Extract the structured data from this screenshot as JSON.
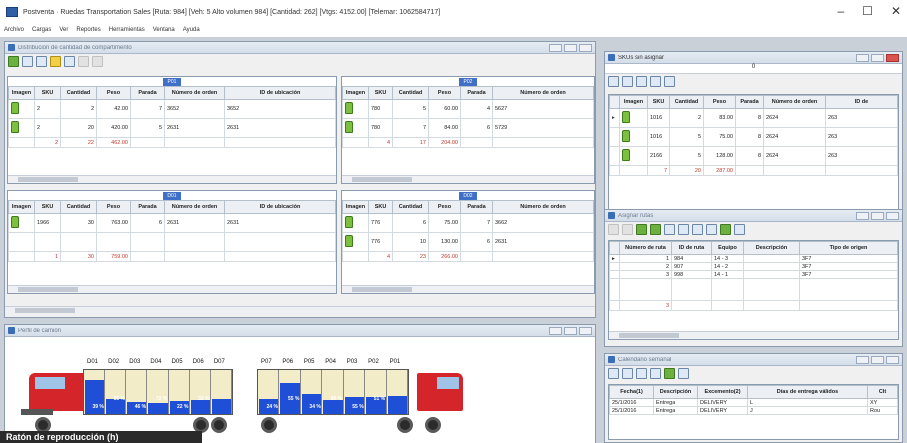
{
  "window": {
    "title": "Postventa · Ruedas Transportation Sales [Ruta: 984] [Veh: 5 Alto volumen 984] [Cantidad: 262] [Vtgs: 4152.00] [Telemar: 1062584717]",
    "controls": [
      "–",
      "☐",
      "✕"
    ]
  },
  "menu": [
    "Archivo",
    "Cargas",
    "Ver",
    "Reportes",
    "Herramientas",
    "Ventana",
    "Ayuda"
  ],
  "panels": {
    "main_title": "Distribución de cantidad de compartimento",
    "skus_title": "SKUs sin asignar",
    "routes_title": "Asignar rutas",
    "perfil_title": "Perfil de camión",
    "calendar_title": "Calendario semanal"
  },
  "columns": [
    "Imagen",
    "SKU",
    "Cantidad",
    "Peso",
    "Parada",
    "Número de orden",
    "ID de ubicación"
  ],
  "grids": [
    {
      "code": "P01",
      "rows": [
        [
          "2",
          "2",
          "42.00",
          "7",
          "3652",
          "3652"
        ],
        [
          "2",
          "20",
          "420.00",
          "5",
          "2631",
          "2631"
        ]
      ],
      "total": [
        "2",
        "22",
        "462.00"
      ]
    },
    {
      "code": "P02",
      "rows": [
        [
          "780",
          "5",
          "60.00",
          "4",
          "5627"
        ],
        [
          "780",
          "7",
          "84.00",
          "6",
          "5729"
        ]
      ],
      "total": [
        "4",
        "17",
        "204.00"
      ]
    },
    {
      "code": "D01",
      "rows": [
        [
          "1966",
          "30",
          "763.00",
          "6",
          "2631",
          "2631"
        ]
      ],
      "total": [
        "1",
        "30",
        "759.00"
      ]
    },
    {
      "code": "D02",
      "rows": [
        [
          "776",
          "6",
          "75.00",
          "7",
          "3662"
        ],
        [
          "776",
          "10",
          "130.00",
          "6",
          "2631"
        ]
      ],
      "total": [
        "4",
        "23",
        "266.00"
      ]
    }
  ],
  "skus": {
    "header": "0",
    "columns": [
      "Imagen",
      "SKU",
      "Cantidad",
      "Peso",
      "Parada",
      "Número de orden",
      "ID de"
    ],
    "rows": [
      [
        "1016",
        "2",
        "83.00",
        "8",
        "2624",
        "263"
      ],
      [
        "1016",
        "5",
        "75.00",
        "8",
        "2624",
        "263"
      ],
      [
        "2166",
        "5",
        "128.00",
        "8",
        "2624",
        "263"
      ]
    ],
    "total": [
      "7",
      "20",
      "287.00"
    ]
  },
  "routes": {
    "columns": [
      "Número de ruta",
      "ID de ruta",
      "Equipo",
      "Descripción",
      "Tipo de origen"
    ],
    "rows": [
      [
        "1",
        "984",
        "14 - 3",
        "3F7"
      ],
      [
        "2",
        "907",
        "14 - 2",
        "3F7"
      ],
      [
        "3",
        "998",
        "14 - 1",
        "3F7"
      ]
    ],
    "total": "3"
  },
  "calendar": {
    "columns": [
      "Fecha(1)",
      "Descripción",
      "Excemento(2)",
      "Días de entrega válidos",
      "Clt"
    ],
    "rows": [
      [
        "25/1/2016",
        "Entrega",
        "DELIVERY",
        "L",
        "XY"
      ],
      [
        "25/1/2016",
        "Entrega",
        "DELIVERY",
        "J",
        "Rou"
      ]
    ]
  },
  "truck": {
    "top_labels": [
      "D01",
      "D02",
      "D03",
      "D04",
      "D05",
      "D06",
      "D07",
      "P07",
      "P06",
      "P05",
      "P04",
      "P03",
      "P02",
      "P01"
    ],
    "left_pcts": [
      "39 %",
      "55 %",
      "46 %",
      "72 %",
      "22 %",
      "33 %"
    ],
    "right_pcts": [
      "24 %",
      "55 %",
      "34 %",
      "66 %",
      "55 %",
      "51 %"
    ],
    "left_fill": [
      0.78,
      0.35,
      0.28,
      0.24,
      0.3,
      0.31,
      0.34
    ],
    "right_fill": [
      0.33,
      0.7,
      0.45,
      0.32,
      0.38,
      0.39,
      0.4
    ]
  },
  "status_overlay": "Ratón de reproducción (h)",
  "colors": {
    "fill_blue": "#1f4fd6",
    "truck_red": "#d4262a",
    "grid_title": "#3f6fc6"
  }
}
